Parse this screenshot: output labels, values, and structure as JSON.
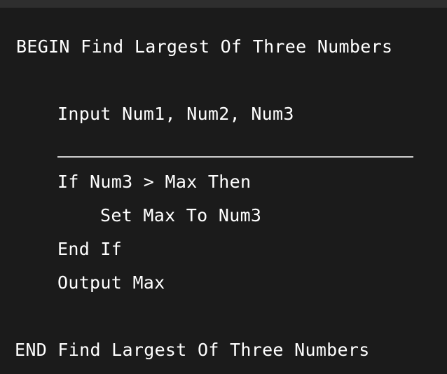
{
  "editor": {
    "background": "#1b1b1b",
    "text_color": "#ffffff",
    "lines": {
      "begin": "BEGIN Find Largest Of Three Numbers",
      "input": "Input Num1, Num2, Num3",
      "if_line": "If Num3 > Max Then",
      "set_line": "Set Max To Num3",
      "end_if": "End If",
      "output": "Output Max",
      "end": "END Find Largest Of Three Numbers"
    }
  }
}
